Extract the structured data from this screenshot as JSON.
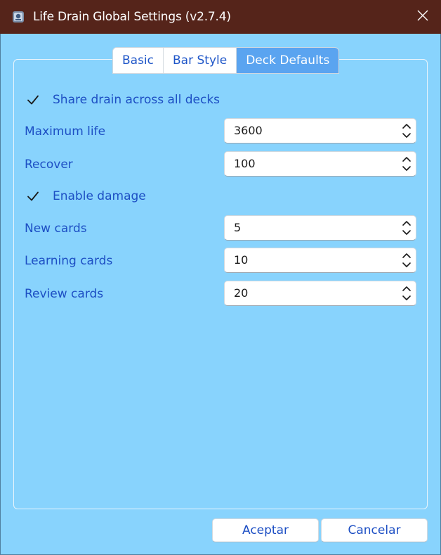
{
  "window": {
    "title": "Life Drain Global Settings (v2.7.4)",
    "titlebar_color": "#55241a",
    "background_color": "#88d3fd",
    "accent_color": "#5aa4f0",
    "icons": {
      "app": "anki-app-icon",
      "close": "close-icon"
    }
  },
  "tabs": [
    {
      "label": "Basic",
      "active": false
    },
    {
      "label": "Bar Style",
      "active": false
    },
    {
      "label": "Deck Defaults",
      "active": true
    }
  ],
  "deck_defaults": {
    "share_drain": {
      "label": "Share drain across all decks",
      "checked": true
    },
    "maximum_life": {
      "label": "Maximum life",
      "value": "3600"
    },
    "recover": {
      "label": "Recover",
      "value": "100"
    },
    "enable_damage": {
      "label": "Enable damage",
      "checked": true
    },
    "new_cards": {
      "label": "New cards",
      "value": "5"
    },
    "learning_cards": {
      "label": "Learning cards",
      "value": "10"
    },
    "review_cards": {
      "label": "Review cards",
      "value": "20"
    }
  },
  "buttons": {
    "ok": "Aceptar",
    "cancel": "Cancelar"
  }
}
